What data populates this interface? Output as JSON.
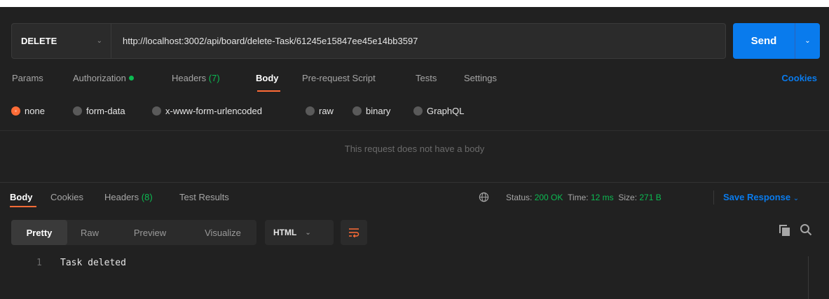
{
  "request": {
    "method": "DELETE",
    "url": "http://localhost:3002/api/board/delete-Task/61245e15847ee45e14bb3597",
    "send_label": "Send"
  },
  "request_tabs": {
    "params": "Params",
    "authorization": "Authorization",
    "headers": "Headers",
    "headers_count": "(7)",
    "body": "Body",
    "prerequest": "Pre-request Script",
    "tests": "Tests",
    "settings": "Settings",
    "cookies": "Cookies"
  },
  "body_types": {
    "none": "none",
    "form_data": "form-data",
    "urlencoded": "x-www-form-urlencoded",
    "raw": "raw",
    "binary": "binary",
    "graphql": "GraphQL",
    "selected": "none"
  },
  "no_body_message": "This request does not have a body",
  "response_tabs": {
    "body": "Body",
    "cookies": "Cookies",
    "headers": "Headers",
    "headers_count": "(8)",
    "test_results": "Test Results"
  },
  "response_status": {
    "status_label": "Status:",
    "status_value": "200 OK",
    "time_label": "Time:",
    "time_value": "12 ms",
    "size_label": "Size:",
    "size_value": "271 B",
    "save_response": "Save Response"
  },
  "view_modes": {
    "pretty": "Pretty",
    "raw": "Raw",
    "preview": "Preview",
    "visualize": "Visualize",
    "format": "HTML"
  },
  "response_body": {
    "line_number": "1",
    "line_text": "Task deleted"
  },
  "colors": {
    "accent_orange": "#ff6c37",
    "send_blue": "#097bed",
    "status_green": "#0cbb52"
  }
}
